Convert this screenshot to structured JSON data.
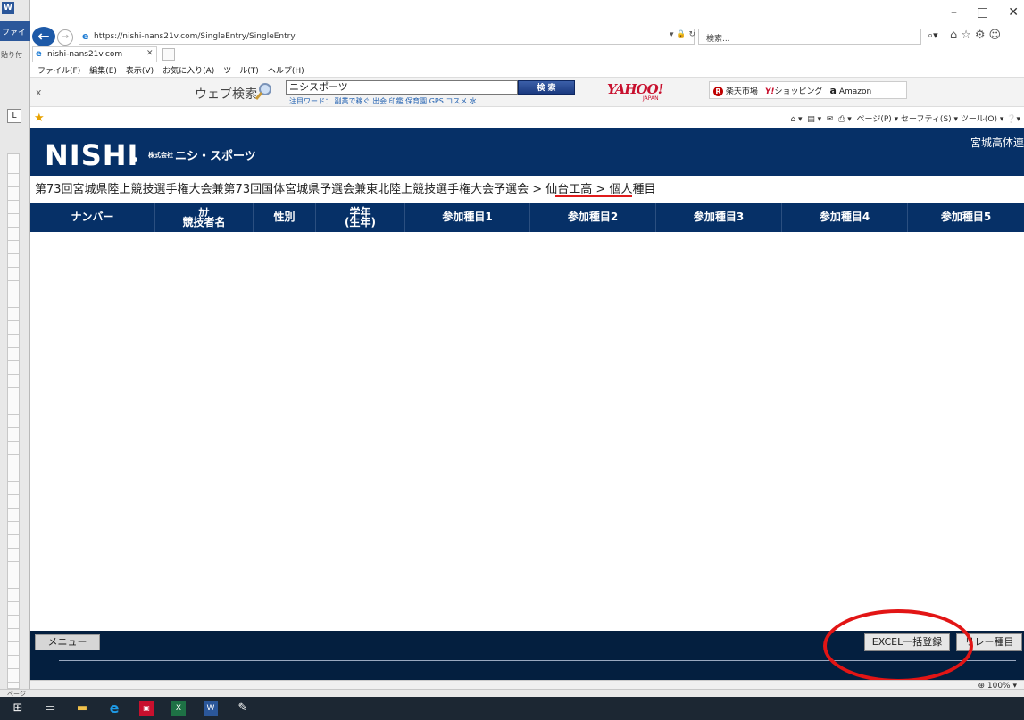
{
  "word": {
    "app_icon": "W",
    "file_tab": "ファイ",
    "paste_label": "貼り付",
    "ruler_btn": "L",
    "status_text": "ページ"
  },
  "browser": {
    "url": "https://nishi-nans21v.com/SingleEntry/SingleEntry",
    "search_placeholder": "検索...",
    "tab_title": "nishi-nans21v.com",
    "menu": [
      "ファイル(F)",
      "編集(E)",
      "表示(V)",
      "お気に入り(A)",
      "ツール(T)",
      "ヘルプ(H)"
    ],
    "window_controls": [
      "–",
      "□",
      "✕"
    ],
    "command_bar": "ページ(P) ▾  セーフティ(S) ▾  ツール(O) ▾",
    "zoom": "100%"
  },
  "yahoo_bar": {
    "web_search_label": "ウェブ検索",
    "query": "ニシスポーツ",
    "search_button": "検 索",
    "hot_words": "注目ワード： 副業で稼ぐ 出会 印鑑 保育園 GPS コスメ 水",
    "logo": "YAHOO!",
    "logo_sub": "JAPAN",
    "links": {
      "rakuten_mark": "R",
      "rakuten": "楽天市場",
      "yshopping_mark": "Y!",
      "yshopping": "ショッピング",
      "amazon_mark": "a",
      "amazon": "Amazon"
    }
  },
  "site": {
    "logo": "NISHI",
    "company_prefix": "株式会社",
    "company": "ニシ・スポーツ",
    "org_name": "宮城高体連"
  },
  "breadcrumb": {
    "competition": "第73回宮城県陸上競技選手権大会兼第73回国体宮城県予選会兼東北陸上競技選手権大会予選会",
    "sep1": " > ",
    "school": "仙台工高",
    "sep2": " > ",
    "current": "個人種目"
  },
  "table": {
    "headers": [
      "ナンバー",
      "ｶﾅ\n競技者名",
      "性別",
      "学年\n(生年)",
      "参加種目1",
      "参加種目2",
      "参加種目3",
      "参加種目4",
      "参加種目5"
    ],
    "rows": []
  },
  "footer": {
    "menu_button": "メニュー",
    "excel_button": "EXCEL一括登録",
    "relay_button": "リレー種目"
  },
  "colors": {
    "header_navy": "#063067",
    "footer_navy": "#041f3f",
    "annotation_red": "#e21515"
  }
}
